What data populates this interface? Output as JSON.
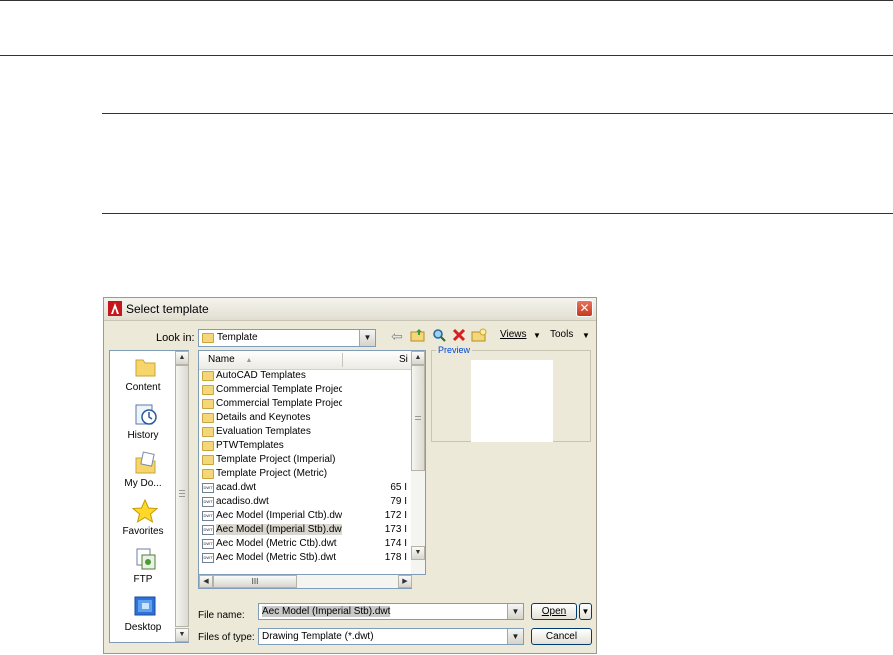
{
  "dialog": {
    "title": "Select template",
    "close_glyph": "✕",
    "look_in_label": "Look in:",
    "look_in_value": "Template",
    "toolbar": {
      "back_icon": "back-arrow-icon",
      "up_icon": "up-folder-icon",
      "search_icon": "search-web-icon",
      "delete_icon": "delete-icon",
      "new_folder_icon": "create-folder-icon",
      "views_label": "Views",
      "tools_label": "Tools"
    },
    "places": [
      {
        "label": "Content",
        "icon": "folder-icon"
      },
      {
        "label": "History",
        "icon": "history-icon"
      },
      {
        "label": "My Do...",
        "icon": "my-documents-icon"
      },
      {
        "label": "Favorites",
        "icon": "favorites-star-icon"
      },
      {
        "label": "FTP",
        "icon": "ftp-icon"
      },
      {
        "label": "Desktop",
        "icon": "desktop-icon"
      }
    ],
    "columns": {
      "name": "Name",
      "size": "Si",
      "sort_glyph": "▲"
    },
    "files": [
      {
        "name": "AutoCAD Templates",
        "size": "",
        "type": "folder"
      },
      {
        "name": "Commercial Template Project...",
        "size": "",
        "type": "folder"
      },
      {
        "name": "Commercial Template Project...",
        "size": "",
        "type": "folder"
      },
      {
        "name": "Details and Keynotes",
        "size": "",
        "type": "folder"
      },
      {
        "name": "Evaluation Templates",
        "size": "",
        "type": "folder"
      },
      {
        "name": "PTWTemplates",
        "size": "",
        "type": "folder"
      },
      {
        "name": "Template Project (Imperial)",
        "size": "",
        "type": "folder"
      },
      {
        "name": "Template Project (Metric)",
        "size": "",
        "type": "folder"
      },
      {
        "name": "acad.dwt",
        "size": "65 I",
        "type": "dwt"
      },
      {
        "name": "acadiso.dwt",
        "size": "79 I",
        "type": "dwt"
      },
      {
        "name": "Aec Model (Imperial Ctb).dwt",
        "size": "172 I",
        "type": "dwt"
      },
      {
        "name": "Aec Model (Imperial Stb).dwt",
        "size": "173 I",
        "type": "dwt",
        "selected": true
      },
      {
        "name": "Aec Model (Metric Ctb).dwt",
        "size": "174 I",
        "type": "dwt"
      },
      {
        "name": "Aec Model (Metric Stb).dwt",
        "size": "178 I",
        "type": "dwt"
      }
    ],
    "hscroll_grip": "III",
    "preview_label": "Preview",
    "file_name_label": "File name:",
    "file_name_value": "Aec Model (Imperial Stb).dwt",
    "files_of_type_label": "Files of type:",
    "files_of_type_value": "Drawing Template (*.dwt)",
    "open_label": "Open",
    "cancel_label": "Cancel"
  }
}
